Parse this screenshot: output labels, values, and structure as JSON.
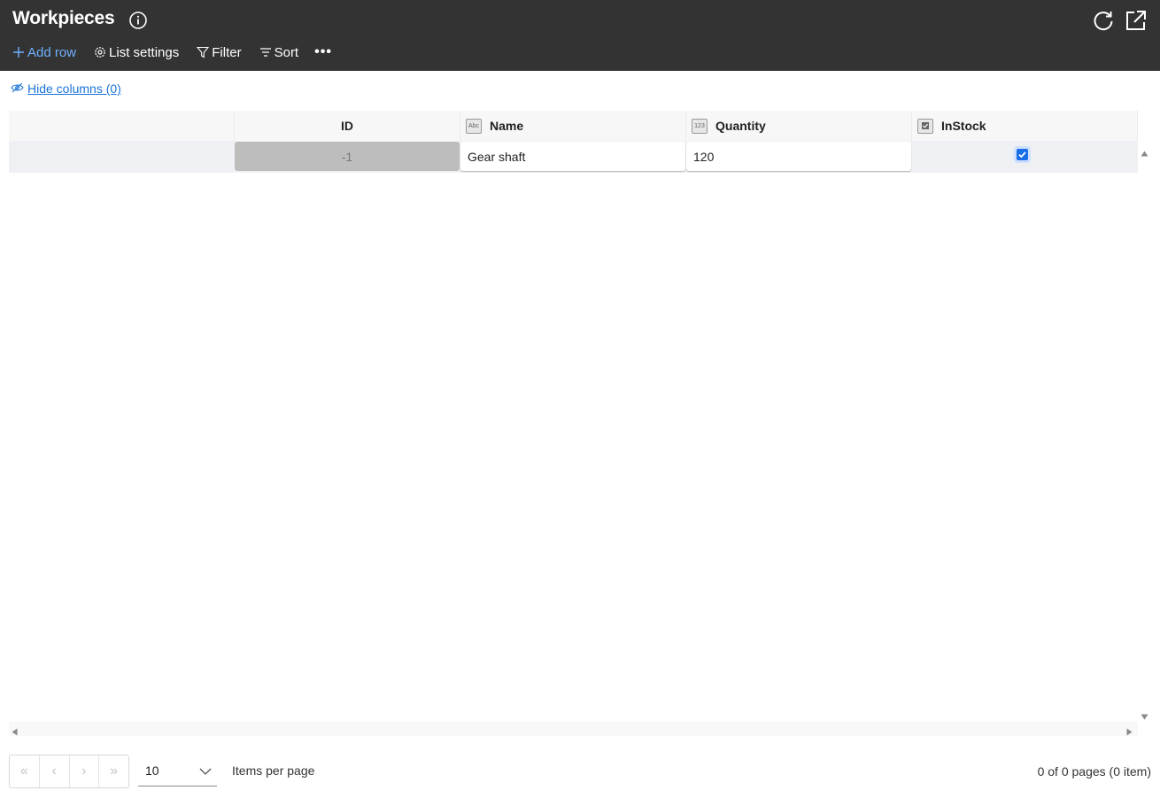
{
  "header": {
    "title": "Workpieces",
    "toolbar": {
      "add_row": "Add row",
      "list_settings": "List settings",
      "filter": "Filter",
      "sort": "Sort",
      "more": "•••"
    }
  },
  "hide_columns": "Hide columns (0)",
  "grid": {
    "columns": [
      {
        "label": "ID",
        "type_icon": ""
      },
      {
        "label": "Name",
        "type_icon": "Abc"
      },
      {
        "label": "Quantity",
        "type_icon": "123"
      },
      {
        "label": "InStock",
        "type_icon": "checkbox"
      }
    ],
    "rows": [
      {
        "id": "-1",
        "name": "Gear shaft",
        "quantity": "120",
        "in_stock": true
      }
    ]
  },
  "pager": {
    "first": "«",
    "prev": "‹",
    "next": "›",
    "last": "»",
    "page_size": "10",
    "items_per_page_label": "Items per page",
    "page_info": "0 of 0 pages (0 item)"
  },
  "colors": {
    "header_bg": "#333333",
    "accent": "#1a6ee8",
    "link": "#1a73d9"
  }
}
